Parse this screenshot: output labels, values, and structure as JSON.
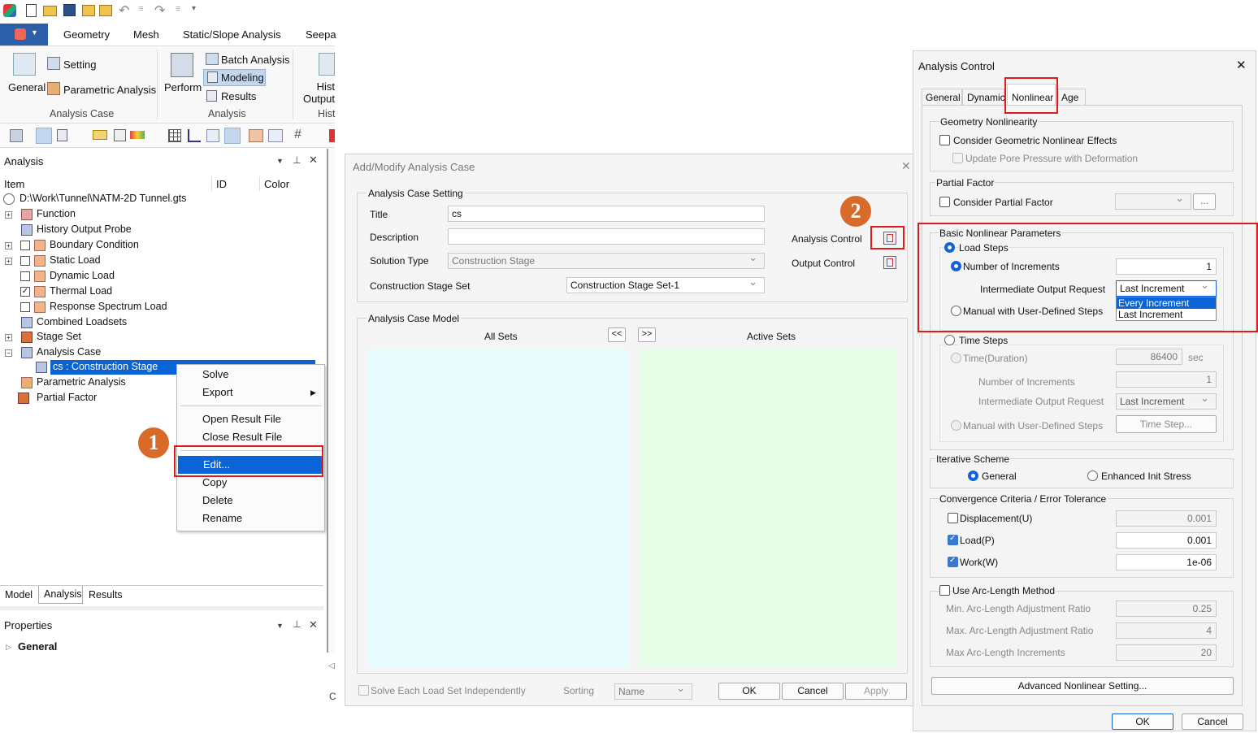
{
  "ribbon": {
    "tabs": [
      "Geometry",
      "Mesh",
      "Static/Slope Analysis",
      "Seepa"
    ],
    "setting": "Setting",
    "general": "General",
    "parametric": "Parametric Analysis",
    "analysis_case_group": "Analysis Case",
    "perform": "Perform",
    "batch": "Batch Analysis",
    "modeling": "Modeling",
    "results": "Results",
    "analysis_group": "Analysis",
    "hist": "Hist",
    "output": "Output",
    "hist2": "Hist"
  },
  "analysis_panel": {
    "title": "Analysis",
    "col_item": "Item",
    "col_id": "ID",
    "col_color": "Color",
    "root": "D:\\Work\\Tunnel\\NATM-2D Tunnel.gts",
    "items": [
      "Function",
      "History Output Probe",
      "Boundary Condition",
      "Static Load",
      "Dynamic Load",
      "Thermal Load",
      "Response Spectrum Load",
      "Combined Loadsets",
      "Stage Set",
      "Analysis Case",
      "cs : Construction Stage",
      "Parametric Analysis",
      "Partial Factor"
    ],
    "bottom_tabs": [
      "Model",
      "Analysis",
      "Results"
    ]
  },
  "properties_panel": {
    "title": "Properties",
    "general": "General"
  },
  "context_menu": {
    "items": [
      "Solve",
      "Export",
      "Open Result File",
      "Close Result File",
      "Edit...",
      "Copy",
      "Delete",
      "Rename"
    ]
  },
  "step_labels": {
    "one": "1",
    "two": "2"
  },
  "add_modify": {
    "title": "Add/Modify Analysis Case",
    "setting_group": "Analysis Case Setting",
    "title_label": "Title",
    "title_value": "cs",
    "description_label": "Description",
    "description_value": "",
    "solution_type_label": "Solution Type",
    "solution_type_value": "Construction Stage",
    "cs_set_label": "Construction Stage Set",
    "cs_set_value": "Construction Stage Set-1",
    "analysis_control": "Analysis Control",
    "output_control": "Output Control",
    "model_group": "Analysis Case Model",
    "all_sets": "All Sets",
    "active_sets": "Active Sets",
    "move_left": "<<",
    "move_right": ">>",
    "solve_each": "Solve Each Load Set Independently",
    "sorting_label": "Sorting",
    "sorting_value": "Name",
    "ok": "OK",
    "cancel": "Cancel",
    "apply": "Apply"
  },
  "analysis_control": {
    "title": "Analysis Control",
    "tabs": [
      "General",
      "Dynamic",
      "Nonlinear",
      "Age"
    ],
    "geo_group": "Geometry Nonlinearity",
    "geo_effects": "Consider Geometric Nonlinear Effects",
    "pore_pressure": "Update Pore Pressure with Deformation",
    "partial_group": "Partial Factor",
    "consider_partial": "Consider Partial Factor",
    "ellipsis": "...",
    "basic_group": "Basic Nonlinear Parameters",
    "load_steps": "Load Steps",
    "num_increments": "Number of Increments",
    "num_increments_value": "1",
    "intermediate_output": "Intermediate Output Request",
    "intermediate_value": "Last Increment",
    "dropdown_options": [
      "Every Increment",
      "Last Increment"
    ],
    "manual_steps": "Manual with User-Defined Steps",
    "time_steps": "Time Steps",
    "time_duration": "Time(Duration)",
    "time_value": "86400",
    "time_unit": "sec",
    "ts_num_increments": "Number of Increments",
    "ts_num_value": "1",
    "ts_intermediate": "Intermediate Output Request",
    "ts_intermediate_value": "Last Increment",
    "ts_manual": "Manual with User-Defined Steps",
    "time_step_btn": "Time Step...",
    "iter_group": "Iterative Scheme",
    "general_radio": "General",
    "enhanced": "Enhanced Init Stress",
    "conv_group": "Convergence Criteria / Error Tolerance",
    "displacement": "Displacement(U)",
    "displacement_value": "0.001",
    "load": "Load(P)",
    "load_value": "0.001",
    "work": "Work(W)",
    "work_value": "1e-06",
    "arc_length": "Use Arc-Length Method",
    "min_arc": "Min. Arc-Length Adjustment Ratio",
    "min_arc_value": "0.25",
    "max_arc": "Max. Arc-Length Adjustment Ratio",
    "max_arc_value": "4",
    "max_arc_inc": "Max Arc-Length Increments",
    "max_arc_inc_value": "20",
    "advanced": "Advanced Nonlinear Setting...",
    "ok": "OK",
    "cancel": "Cancel"
  },
  "colors": {
    "accent_blue": "#1463d6",
    "highlight": "#0a64d6",
    "callout_red": "#e0191d",
    "step_orange": "#d86a2a",
    "all_sets_bg": "#e8fbfd",
    "active_sets_bg": "#e8fde8"
  }
}
